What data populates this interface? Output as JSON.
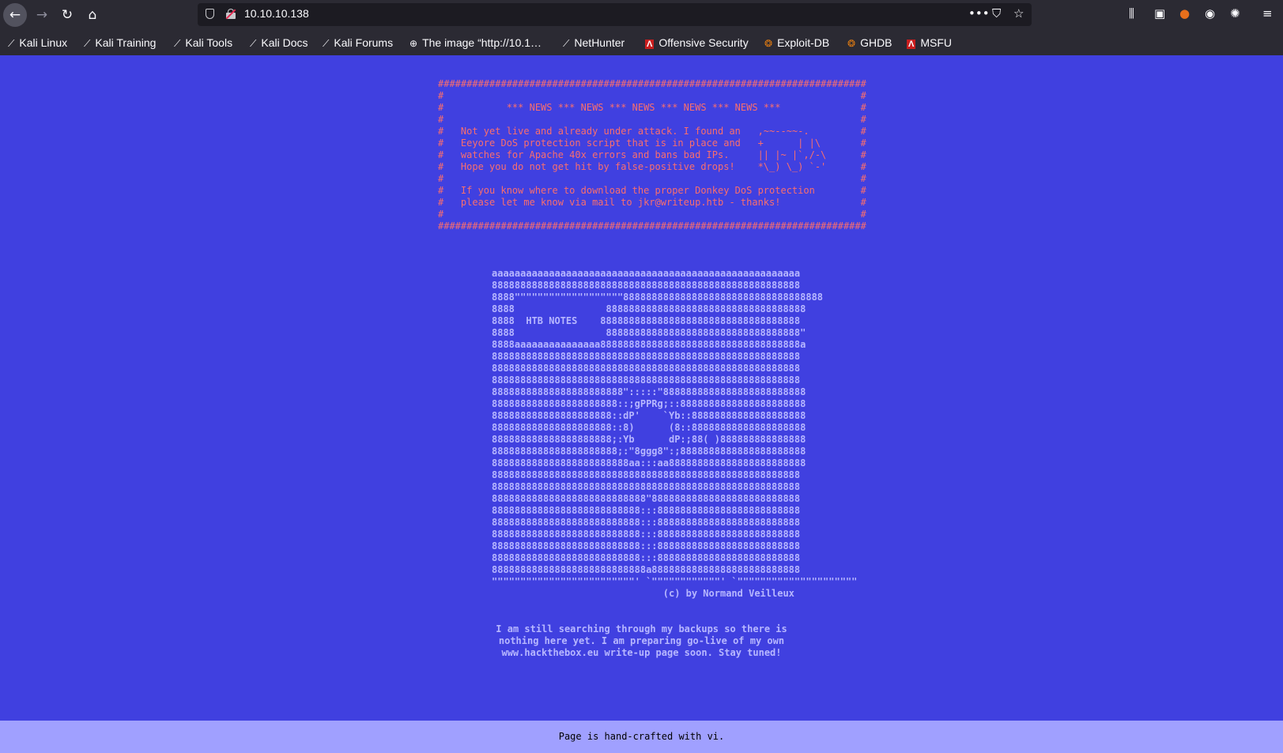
{
  "browser": {
    "url": "10.10.10.138",
    "bookmarks": [
      "Kali Linux",
      "Kali Training",
      "Kali Tools",
      "Kali Docs",
      "Kali Forums",
      "The image “http://10.1…",
      "NetHunter",
      "Offensive Security",
      "Exploit-DB",
      "GHDB",
      "MSFU"
    ]
  },
  "page": {
    "news_box": "###########################################################################\n#                                                                         #\n#           *** NEWS *** NEWS *** NEWS *** NEWS *** NEWS ***              #\n#                                                                         #\n#   Not yet live and already under attack. I found an   ,~~--~~-.         #\n#   Eeyore DoS protection script that is in place and   +      | |\\       #\n#   watches for Apache 40x errors and bans bad IPs.     || |~ |`,/-\\      #\n#   Hope you do not get hit by false-positive drops!    *\\_) \\_) `-'      #\n#                                                                         #\n#   If you know where to download the proper Donkey DoS protection        #\n#   please let me know via mail to jkr@writeup.htb - thanks!              #\n#                                                                         #\n###########################################################################",
    "ascii_art": "aaaaaaaaaaaaaaaaaaaaaaaaaaaaaaaaaaaaaaaaaaaaaaaaaaaaaa\n888888888888888888888888888888888888888888888888888888\n8888\"\"\"\"\"\"\"\"\"\"\"\"\"\"\"\"\"\"\"88888888888888888888888888888888888\n8888                88888888888888888888888888888888888\n8888  HTB NOTES    88888888888888888888888888888888888\n8888                8888888888888888888888888888888888\"\n8888aaaaaaaaaaaaaaa88888888888888888888888888888888888a\n888888888888888888888888888888888888888888888888888888\n888888888888888888888888888888888888888888888888888888\n888888888888888888888888888888888888888888888888888888\n88888888888888888888888\":::::\"8888888888888888888888888\n8888888888888888888888::;gPPRg;::8888888888888888888888\n888888888888888888888::dP'    `Yb::88888888888888888888\n888888888888888888888::8)      (8::88888888888888888888\n888888888888888888888;:Yb      dP:;88( )888888888888888\n8888888888888888888888;:\"8ggg8\":;8888888888888888888888\n888888888888888888888888aa:::aa888888888888888888888888\n888888888888888888888888888888888888888888888888888888\n888888888888888888888888888888888888888888888888888888\n888888888888888888888888888\"88888888888888888888888888\n88888888888888888888888888:::8888888888888888888888888\n88888888888888888888888888:::8888888888888888888888888\n88888888888888888888888888:::8888888888888888888888888\n88888888888888888888888888:::8888888888888888888888888\n88888888888888888888888888:::8888888888888888888888888\n888888888888888888888888888a88888888888888888888888888\n\"\"\"\"\"\"\"\"\"\"\"\"\"\"\"\"\"\"\"\"\"\"\"\"\"' `\"\"\"\"\"\"\"\"\"\"\"\"' `\"\"\"\"\"\"\"\"\"\"\"\"\"\"\"\"\"\"\"\"\"\n                              (c) by Normand Veilleux",
    "message": "I am still searching through my backups so there is\nnothing here yet. I am preparing go-live of my own\nwww.hackthebox.eu write-up page soon. Stay tuned!",
    "footer": "Page is hand-crafted with vi."
  }
}
